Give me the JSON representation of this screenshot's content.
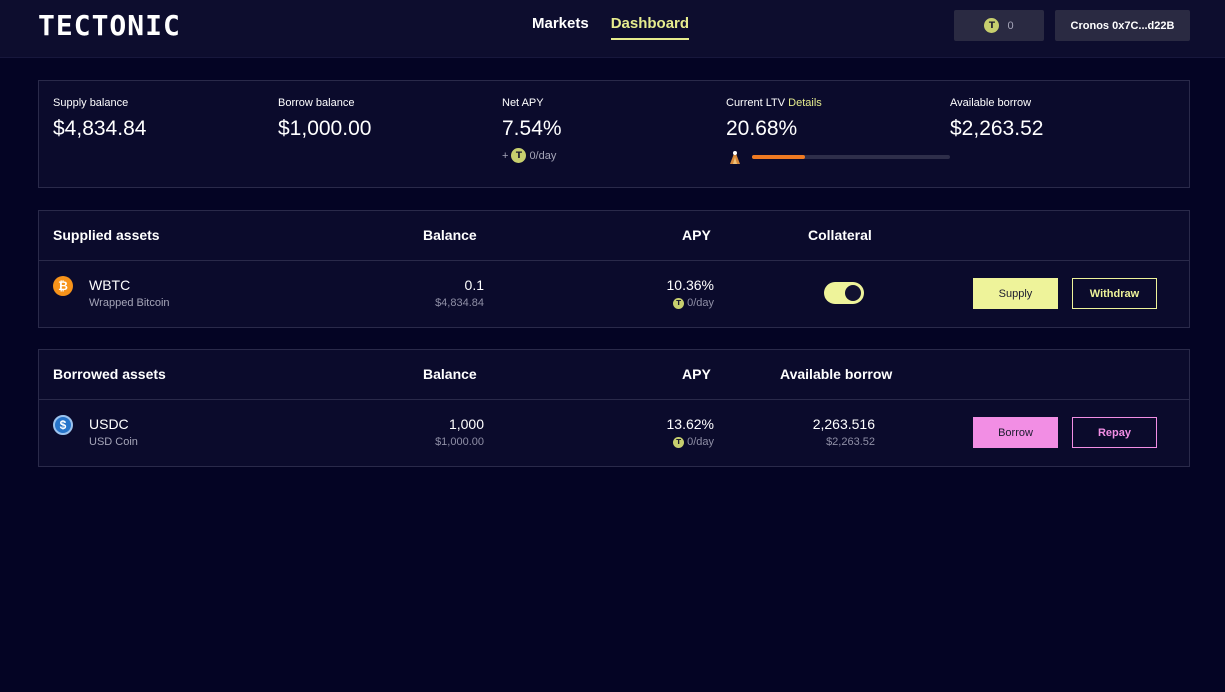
{
  "header": {
    "logo": "TECTONIC",
    "nav": [
      "Markets",
      "Dashboard"
    ],
    "active_nav": "Dashboard",
    "tonic_balance": "0",
    "wallet": "Cronos 0x7C...d22B"
  },
  "summary": {
    "supply_balance": {
      "label": "Supply balance",
      "value": "$4,834.84"
    },
    "borrow_balance": {
      "label": "Borrow balance",
      "value": "$1,000.00"
    },
    "net_apy": {
      "label": "Net APY",
      "value": "7.54%",
      "reward_prefix": "+",
      "reward": "0/day"
    },
    "current_ltv": {
      "label": "Current LTV",
      "details_link": "Details",
      "value": "20.68%",
      "progress_percent": 27
    },
    "available_borrow": {
      "label": "Available borrow",
      "value": "$2,263.52"
    }
  },
  "supplied": {
    "headers": {
      "title": "Supplied assets",
      "balance": "Balance",
      "apy": "APY",
      "collateral": "Collateral"
    },
    "row": {
      "symbol": "WBTC",
      "name": "Wrapped Bitcoin",
      "balance": "0.1",
      "balance_usd": "$4,834.84",
      "apy": "10.36%",
      "reward": "0/day",
      "collateral_enabled": true,
      "supply_label": "Supply",
      "withdraw_label": "Withdraw"
    }
  },
  "borrowed": {
    "headers": {
      "title": "Borrowed assets",
      "balance": "Balance",
      "apy": "APY",
      "available": "Available borrow"
    },
    "row": {
      "symbol": "USDC",
      "name": "USD Coin",
      "balance": "1,000",
      "balance_usd": "$1,000.00",
      "apy": "13.62%",
      "reward": "0/day",
      "available": "2,263.516",
      "available_usd": "$2,263.52",
      "borrow_label": "Borrow",
      "repay_label": "Repay"
    }
  },
  "colors": {
    "accent_yellow": "#eef39a",
    "accent_pink": "#f28ee4",
    "ltv_fill": "#f07a22",
    "wbtc": "#f7931a",
    "usdc": "#2775ca"
  }
}
